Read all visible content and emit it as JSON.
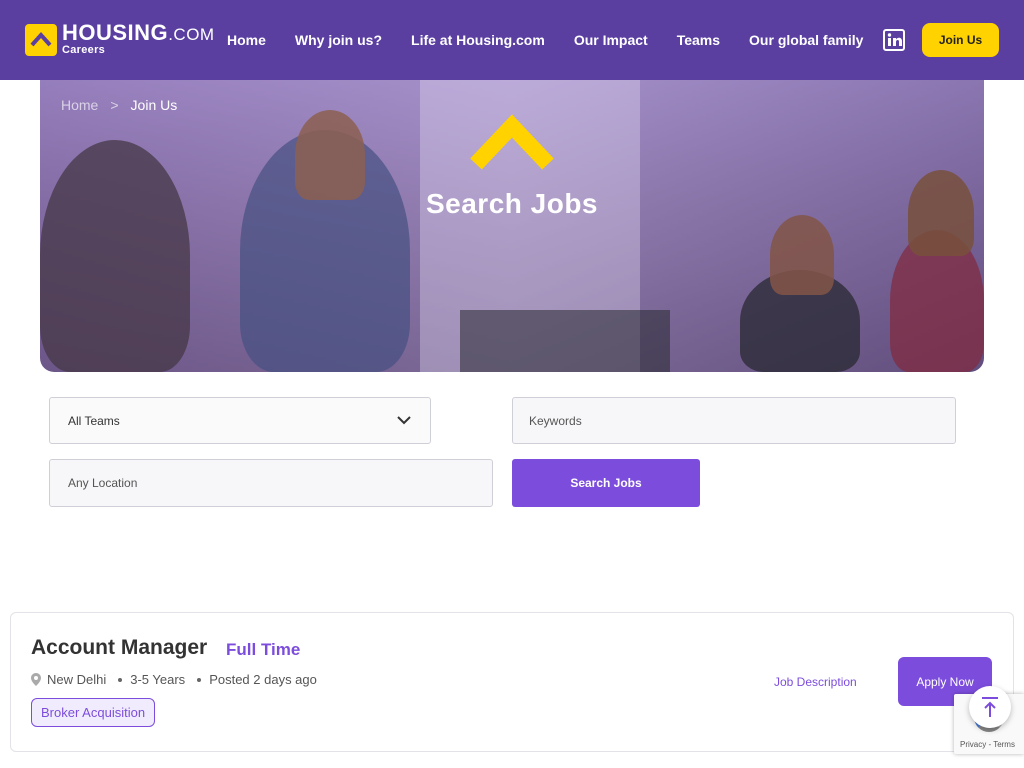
{
  "header": {
    "logo": {
      "brand": "HOUSING",
      "dotcom": ".COM",
      "sub": "Careers"
    },
    "nav": [
      "Home",
      "Why join us?",
      "Life at Housing.com",
      "Our Impact",
      "Teams",
      "Our global family"
    ],
    "linkedin_icon": "linkedin-icon",
    "join_label": "Join Us",
    "colors": {
      "bg": "#5a3fa1",
      "accent": "#ffd200"
    }
  },
  "hero": {
    "breadcrumb": {
      "home": "Home",
      "separator": ">",
      "current": "Join Us"
    },
    "title": "Search Jobs"
  },
  "search": {
    "team_select_value": "All Teams",
    "keywords_placeholder": "Keywords",
    "location_placeholder": "Any Location",
    "button_label": "Search Jobs"
  },
  "job": {
    "title": "Account Manager",
    "type": "Full Time",
    "location": "New Delhi",
    "experience": "3-5 Years",
    "posted": "Posted 2 days ago",
    "tag": "Broker Acquisition",
    "description_link": "Job Description",
    "apply_label": "Apply Now"
  },
  "recaptcha": {
    "text": "Privacy - Terms"
  },
  "brand_color": "#7c4ddc"
}
